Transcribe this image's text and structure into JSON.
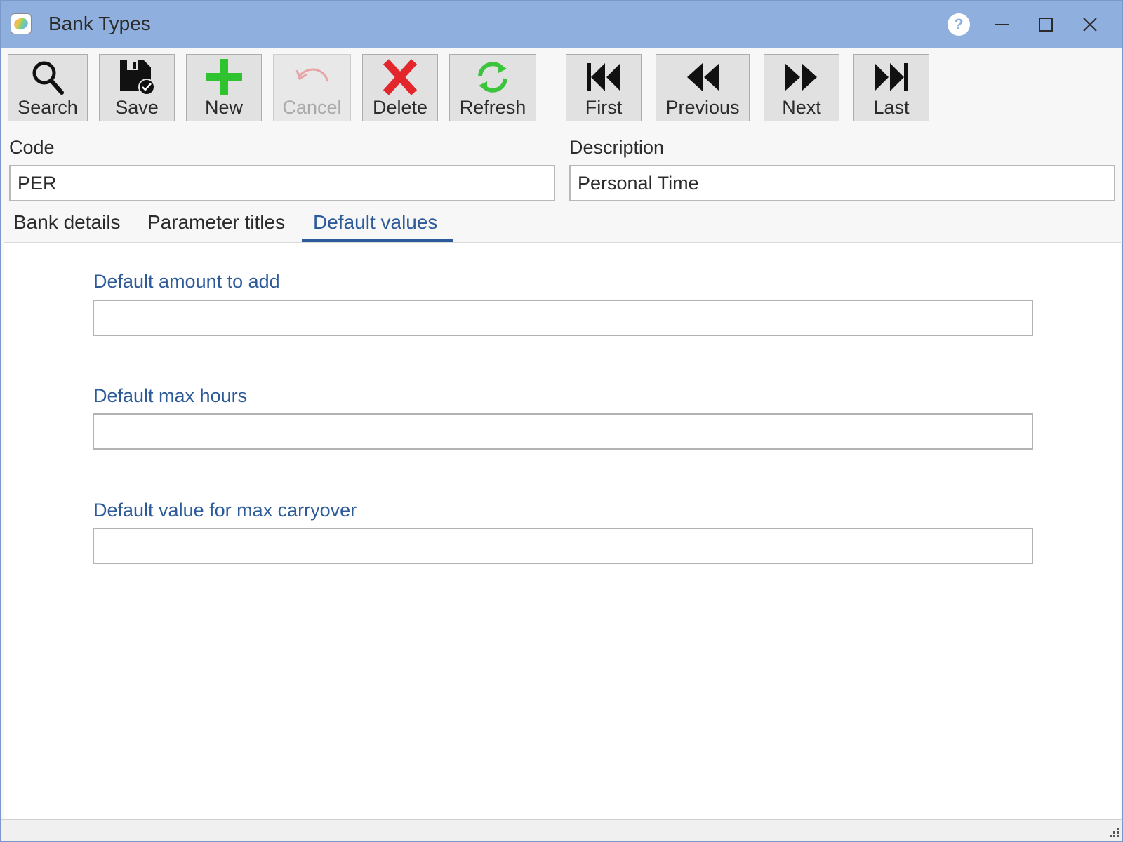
{
  "window": {
    "title": "Bank Types",
    "help_label": "?"
  },
  "toolbar": {
    "search": "Search",
    "save": "Save",
    "new": "New",
    "cancel": "Cancel",
    "delete": "Delete",
    "refresh": "Refresh",
    "first": "First",
    "previous": "Previous",
    "next": "Next",
    "last": "Last"
  },
  "form": {
    "code_label": "Code",
    "code_value": "PER",
    "description_label": "Description",
    "description_value": "Personal Time"
  },
  "tabs": [
    {
      "label": "Bank details",
      "active": false
    },
    {
      "label": "Parameter titles",
      "active": false
    },
    {
      "label": "Default values",
      "active": true
    }
  ],
  "default_values": {
    "amount_to_add_label": "Default amount to add",
    "amount_to_add_value": "",
    "max_hours_label": "Default max hours",
    "max_hours_value": "",
    "max_carryover_label": "Default value for max carryover",
    "max_carryover_value": ""
  },
  "colors": {
    "titlebar": "#8fb0de",
    "accent": "#2d5b9a",
    "new_icon": "#2fc42f",
    "delete_icon": "#e2262b",
    "refresh_icon": "#3cc43c",
    "cancel_icon": "#e8a3a3"
  }
}
